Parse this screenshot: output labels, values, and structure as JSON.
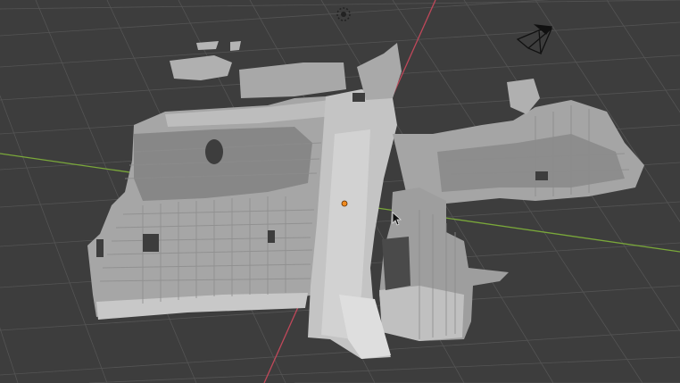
{
  "viewport": {
    "background": "#3d3d3d",
    "grid_color": "#545454",
    "x_axis_color": "#c0485a",
    "y_axis_color": "#7aa83a",
    "mesh_color": "#b8b8b8",
    "mesh_shadow_color": "#6a6a6a",
    "origin_color": "#f08a1e"
  },
  "icons": {
    "light": "light-icon",
    "camera": "camera-icon",
    "cursor": "mouse-cursor-icon",
    "origin": "3d-cursor-origin-icon"
  }
}
